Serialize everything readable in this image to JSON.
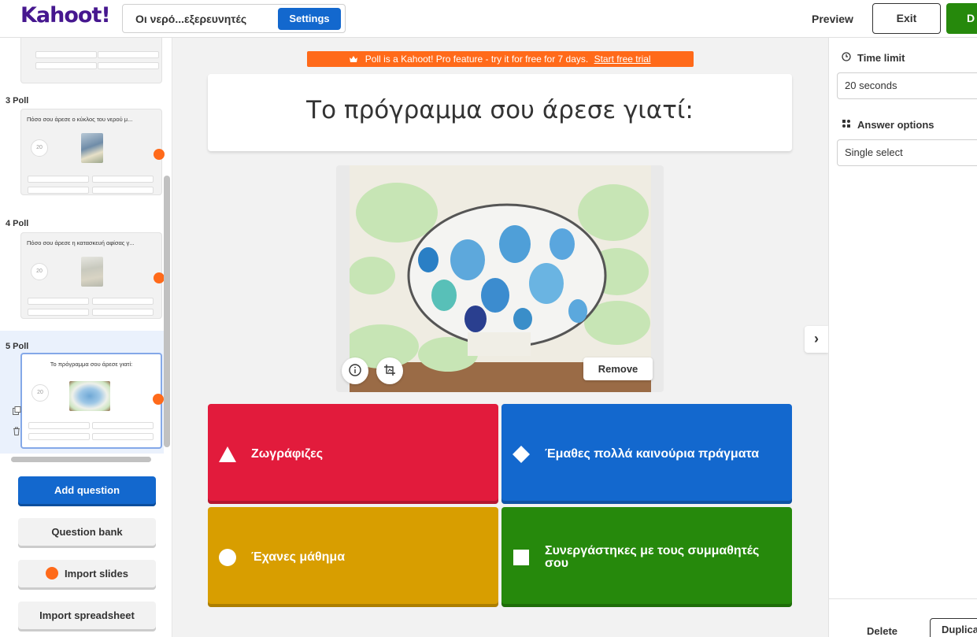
{
  "header": {
    "logo": "Kahoot!",
    "kahoot_title": "Οι νερό...εξερευνητές",
    "settings_label": "Settings",
    "preview_label": "Preview",
    "exit_label": "Exit",
    "done_label": "D"
  },
  "sidebar": {
    "slides": [
      {
        "label": "3 Poll",
        "question": "Πόσο σου άρεσε ο κύκλος του νερού μ...",
        "time": "20"
      },
      {
        "label": "4 Poll",
        "question": "Πόσο σου άρεσε η κατασκευή αφίσας γ...",
        "time": "20"
      },
      {
        "label": "5 Poll",
        "question": "Το πρόγραμμα σου άρεσε γιατί:",
        "time": "20"
      }
    ],
    "add_question": "Add question",
    "question_bank": "Question bank",
    "import_slides": "Import slides",
    "import_spreadsheet": "Import spreadsheet"
  },
  "editor": {
    "pro_banner": "Poll is a Kahoot! Pro feature - try it for free for 7 days.",
    "pro_banner_link": "Start free trial",
    "question": "Το πρόγραμμα σου άρεσε γιατί:",
    "remove_label": "Remove",
    "answers": [
      {
        "text": "Ζωγράφιζες",
        "shape": "triangle",
        "color": "#e21b3c"
      },
      {
        "text": "Έμαθες πολλά καινούρια πράγματα",
        "shape": "diamond",
        "color": "#1368ce"
      },
      {
        "text": "Έχανες μάθημα",
        "shape": "circle",
        "color": "#d89e00"
      },
      {
        "text": "Συνεργάστηκες με τους συμμαθητές σου",
        "shape": "square",
        "color": "#26890c"
      }
    ]
  },
  "right_panel": {
    "time_limit_label": "Time limit",
    "time_limit_value": "20 seconds",
    "answer_options_label": "Answer options",
    "answer_options_value": "Single select",
    "delete_label": "Delete",
    "duplicate_label": "Duplicate"
  },
  "icons": {
    "crown": "crown-icon",
    "info": "info-icon",
    "crop": "crop-image-icon",
    "clock": "clock-icon",
    "options": "answer-options-icon",
    "chevron": "chevron-right-icon",
    "duplicate": "duplicate-icon",
    "trash": "trash-icon"
  },
  "colors": {
    "brand": "#46178f",
    "primary_button": "#1368ce",
    "pro_banner": "#ff6a1a"
  }
}
